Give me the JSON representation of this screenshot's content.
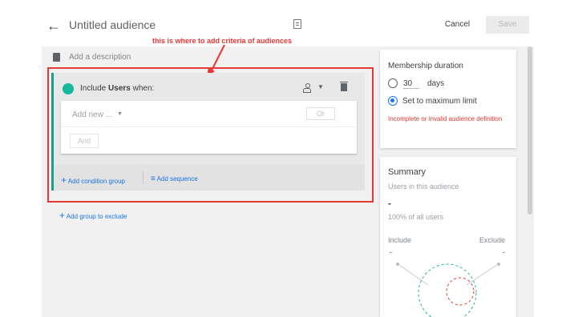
{
  "header": {
    "title": "Untitled audience",
    "cancel_label": "Cancel",
    "save_label": "Save"
  },
  "annotation": {
    "text": "this is where to add criteria of audiences",
    "color": "#e53935"
  },
  "description": {
    "placeholder": "Add a description"
  },
  "group": {
    "include_prefix": "Include",
    "include_subject": "Users",
    "include_suffix": "when:",
    "add_new_placeholder": "Add new ...",
    "or_label": "Or",
    "and_label": "And",
    "add_condition_group_label": "Add condition group",
    "add_sequence_label": "Add sequence",
    "accent_color": "#16a08c"
  },
  "exclude": {
    "add_group_label": "Add group to exclude"
  },
  "membership": {
    "title": "Membership duration",
    "days_value": "30",
    "days_label": "days",
    "max_label": "Set to maximum limit",
    "selected_option": "max",
    "error_text": "Incomplete or invalid audience definition"
  },
  "summary": {
    "title": "Summary",
    "subtitle": "Users in this audience",
    "count": "-",
    "percent_text": "100% of all users",
    "include_label": "Include",
    "exclude_label": "Exclude",
    "include_value": "-",
    "exclude_value": "-"
  },
  "colors": {
    "link_blue": "#1a73e8",
    "error_red": "#e53935",
    "teal": "#16b89c"
  }
}
